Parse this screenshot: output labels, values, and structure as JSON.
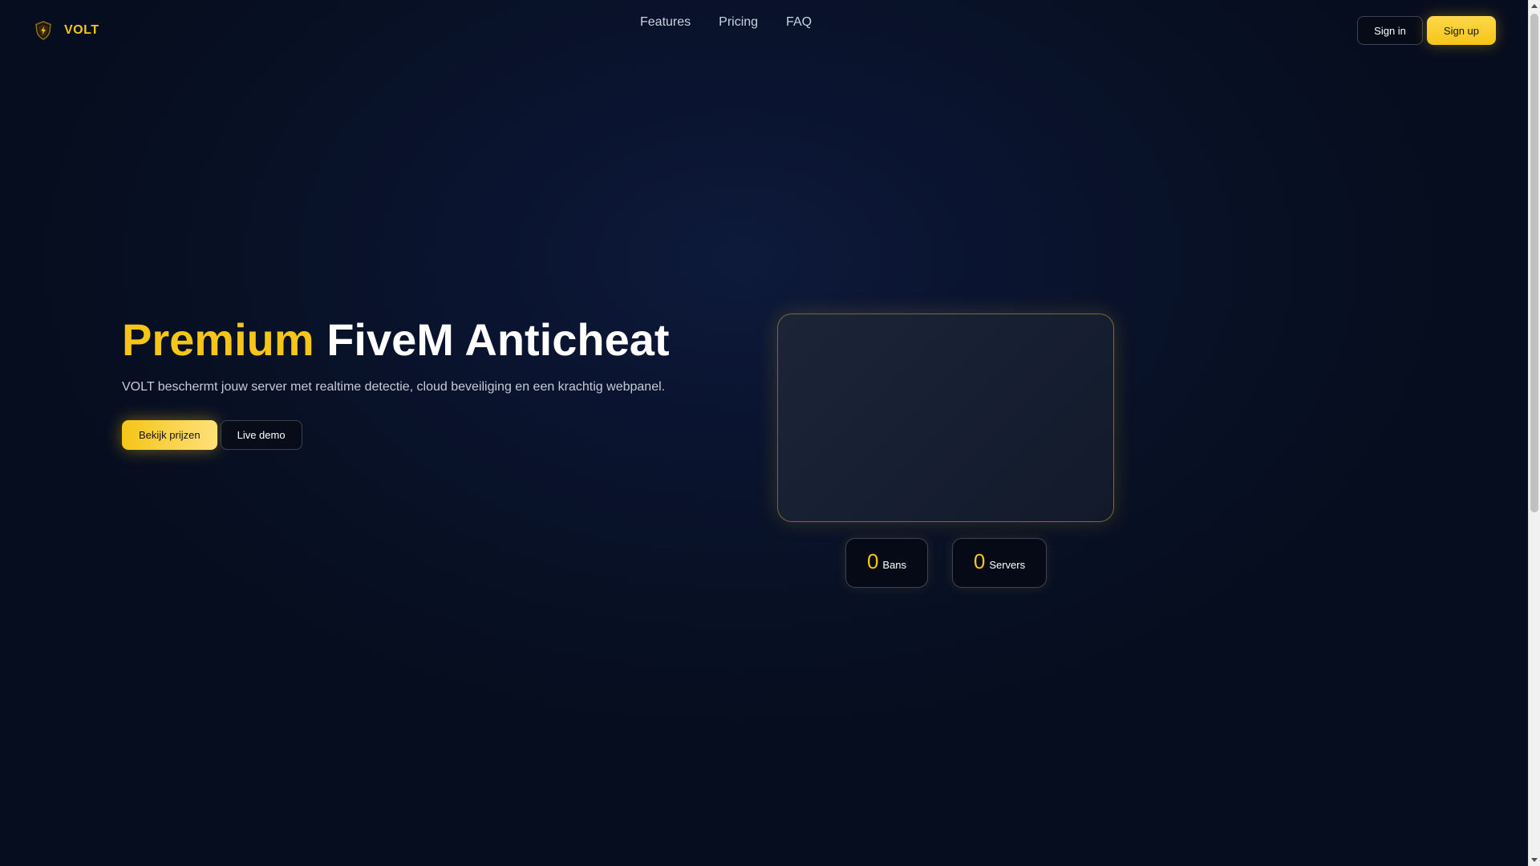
{
  "header": {
    "brand": "VOLT",
    "nav": [
      "Features",
      "Pricing",
      "FAQ"
    ],
    "sign_in": "Sign in",
    "sign_up": "Sign up"
  },
  "hero": {
    "title_accent": "Premium",
    "title_rest": "FiveM Anticheat",
    "subtitle": "VOLT beschermt jouw server met realtime detectie, cloud beveiliging en een krachtig webpanel.",
    "primary_button": "Bekijk prijzen",
    "secondary_button": "Live demo"
  },
  "stats": {
    "bans": {
      "value": "0",
      "label": "Bans"
    },
    "servers": {
      "value": "0",
      "label": "Servers"
    }
  },
  "colors": {
    "accent": "#f5c518",
    "background": "#0a1430",
    "text": "#ffffff"
  },
  "icons": {
    "brand": "shield-bolt-icon"
  }
}
